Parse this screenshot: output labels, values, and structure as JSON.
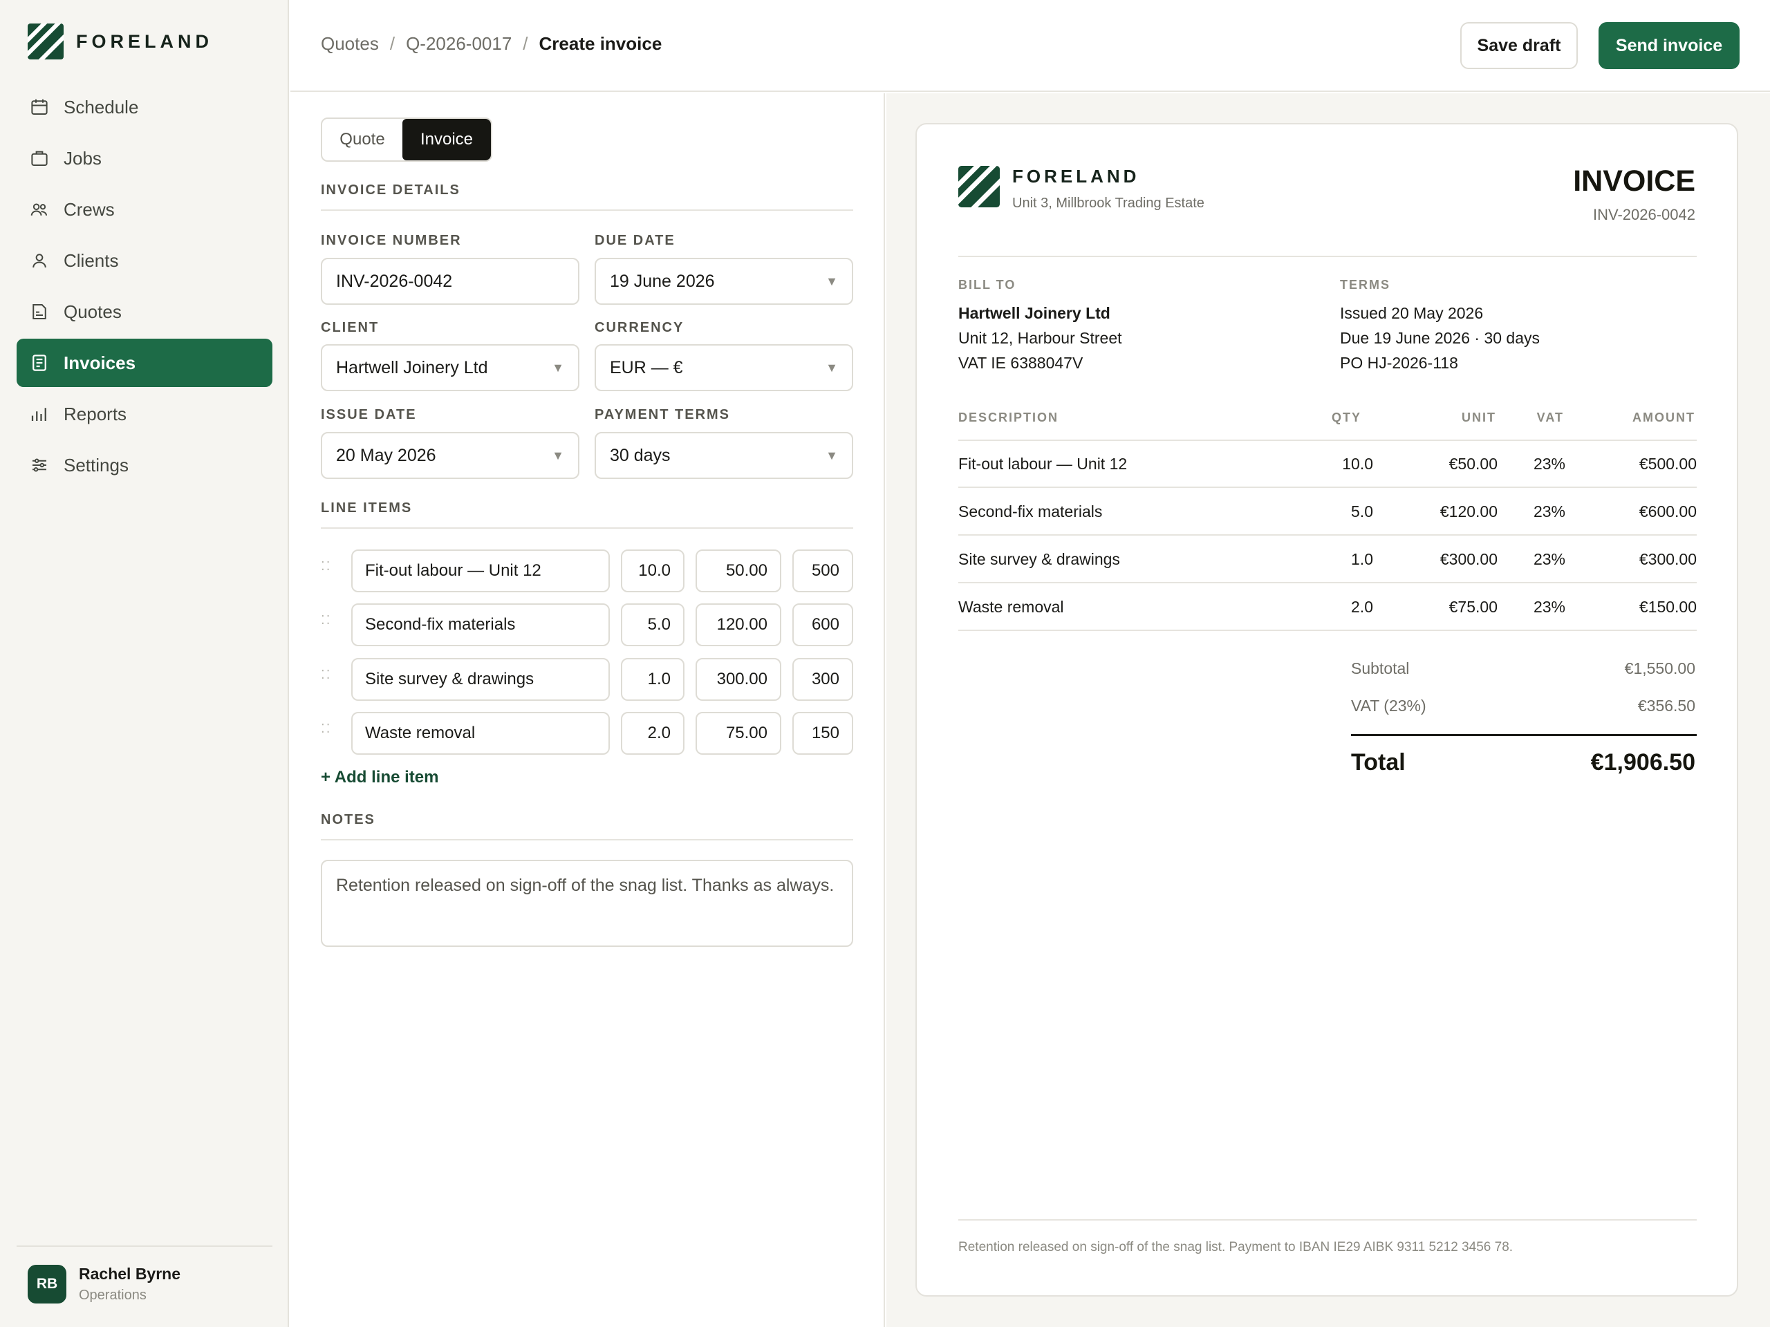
{
  "brand": {
    "name": "FORELAND",
    "address": "Unit 3, Millbrook Trading Estate"
  },
  "colors": {
    "accent": "#1d6b47",
    "accent_dark": "#174b33",
    "sidebar_bg": "#f6f5f1"
  },
  "sidebar": {
    "items": [
      {
        "label": "Schedule",
        "icon": "calendar-icon",
        "active": false
      },
      {
        "label": "Jobs",
        "icon": "briefcase-icon",
        "active": false
      },
      {
        "label": "Crews",
        "icon": "users-icon",
        "active": false
      },
      {
        "label": "Clients",
        "icon": "user-icon",
        "active": false
      },
      {
        "label": "Quotes",
        "icon": "quote-doc-icon",
        "active": false
      },
      {
        "label": "Invoices",
        "icon": "invoice-doc-icon",
        "active": true
      },
      {
        "label": "Reports",
        "icon": "bar-chart-icon",
        "active": false
      },
      {
        "label": "Settings",
        "icon": "sliders-icon",
        "active": false
      }
    ],
    "user": {
      "initials": "RB",
      "name": "Rachel Byrne",
      "role": "Operations"
    }
  },
  "header": {
    "breadcrumb": [
      "Quotes",
      "Q-2026-0017",
      "Create invoice"
    ],
    "separator": "/",
    "save_label": "Save draft",
    "send_label": "Send invoice"
  },
  "form": {
    "toggle": {
      "quote": "Quote",
      "invoice": "Invoice",
      "selected": "Invoice"
    },
    "section_details": "INVOICE DETAILS",
    "invoice_number": {
      "label": "INVOICE NUMBER",
      "value": "INV-2026-0042"
    },
    "due_date": {
      "label": "DUE DATE",
      "value": "19 June 2026"
    },
    "client": {
      "label": "CLIENT",
      "value": "Hartwell Joinery Ltd"
    },
    "currency": {
      "label": "CURRENCY",
      "value": "EUR — €"
    },
    "issue_date": {
      "label": "ISSUE DATE",
      "value": "20 May 2026"
    },
    "payment_terms": {
      "label": "PAYMENT TERMS",
      "value": "30 days"
    },
    "section_lines": "LINE ITEMS",
    "line_items": [
      {
        "description": "Fit-out labour — Unit 12",
        "qty": "10.0",
        "unit": "50.00",
        "amount": "500"
      },
      {
        "description": "Second-fix materials",
        "qty": "5.0",
        "unit": "120.00",
        "amount": "600"
      },
      {
        "description": "Site survey & drawings",
        "qty": "1.0",
        "unit": "300.00",
        "amount": "300"
      },
      {
        "description": "Waste removal",
        "qty": "2.0",
        "unit": "75.00",
        "amount": "150"
      }
    ],
    "add_line": "+ Add line item",
    "section_notes": "NOTES",
    "notes": "Retention released on sign-off of the snag list. Thanks as always."
  },
  "preview": {
    "title": "INVOICE",
    "number": "INV-2026-0042",
    "bill_to_label": "BILL TO",
    "bill_to": [
      "Hartwell Joinery Ltd",
      "Unit 12, Harbour Street",
      "VAT IE 6388047V"
    ],
    "terms_label": "TERMS",
    "terms": [
      "Issued 20 May 2026",
      "Due 19 June 2026 · 30 days",
      "PO HJ-2026-118"
    ],
    "columns": {
      "description": "DESCRIPTION",
      "qty": "QTY",
      "unit": "UNIT",
      "vat": "VAT",
      "amount": "AMOUNT"
    },
    "rows": [
      {
        "description": "Fit-out labour — Unit 12",
        "qty": "10.0",
        "unit": "€50.00",
        "vat": "23%",
        "amount": "€500.00"
      },
      {
        "description": "Second-fix materials",
        "qty": "5.0",
        "unit": "€120.00",
        "vat": "23%",
        "amount": "€600.00"
      },
      {
        "description": "Site survey & drawings",
        "qty": "1.0",
        "unit": "€300.00",
        "vat": "23%",
        "amount": "€300.00"
      },
      {
        "description": "Waste removal",
        "qty": "2.0",
        "unit": "€75.00",
        "vat": "23%",
        "amount": "€150.00"
      }
    ],
    "subtotal_label": "Subtotal",
    "subtotal": "€1,550.00",
    "vat_label": "VAT (23%)",
    "vat": "€356.50",
    "total_label": "Total",
    "total": "€1,906.50",
    "footer": "Retention released on sign-off of the snag list. Payment to IBAN IE29 AIBK 9311 5212 3456 78."
  }
}
